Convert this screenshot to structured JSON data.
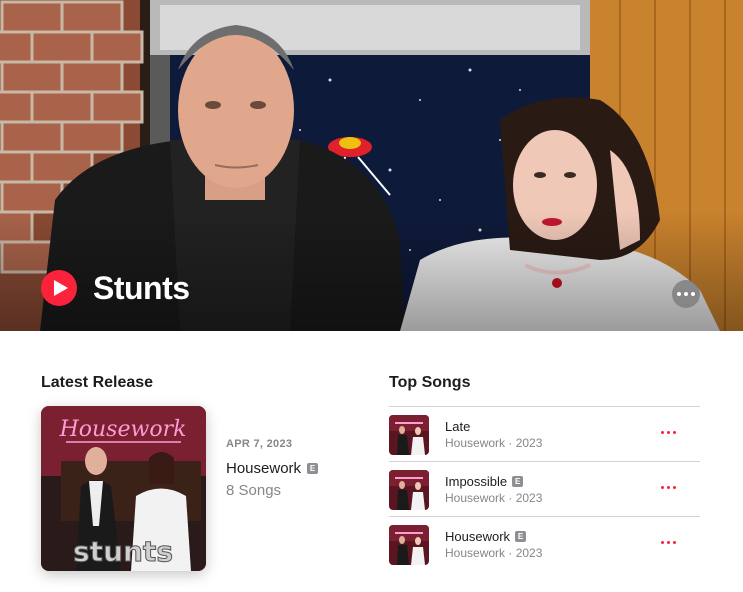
{
  "artist": {
    "name": "Stunts"
  },
  "colors": {
    "accent": "#fa233b",
    "secondary_text": "#86868b"
  },
  "latest_release": {
    "section_title": "Latest Release",
    "date": "APR 7, 2023",
    "title": "Housework",
    "explicit_badge": "E",
    "count": "8 Songs",
    "art_text": {
      "neon_title": "Housework",
      "band_logo": "stunts"
    }
  },
  "top_songs": {
    "section_title": "Top Songs",
    "items": [
      {
        "title": "Late",
        "explicit": false,
        "subtitle": "Housework · 2023"
      },
      {
        "title": "Impossible",
        "explicit": true,
        "badge": "E",
        "subtitle": "Housework · 2023"
      },
      {
        "title": "Housework",
        "explicit": true,
        "badge": "E",
        "subtitle": "Housework · 2023"
      }
    ]
  },
  "icons": {
    "play": "play-icon",
    "more": "more-icon"
  }
}
